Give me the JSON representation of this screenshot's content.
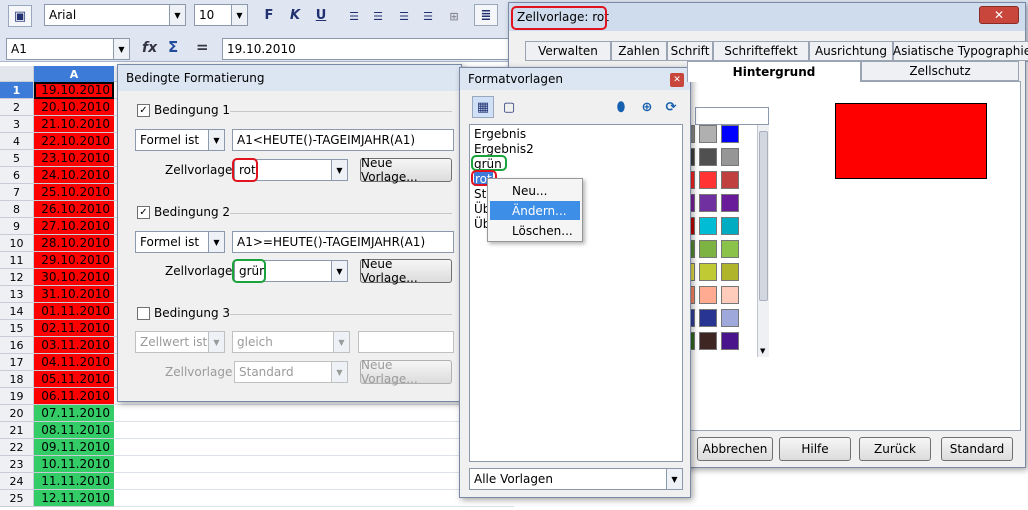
{
  "toolbar": {
    "font_name": "Arial",
    "font_size": "10",
    "bold": "F",
    "italic": "K",
    "underline": "U"
  },
  "formula_bar": {
    "cell_ref": "A1",
    "content": "19.10.2010",
    "fx": "fx",
    "sum": "Σ",
    "eq": "="
  },
  "sheet": {
    "column_header": "A",
    "rows": [
      {
        "n": "1",
        "v": "19.10.2010",
        "c": "red"
      },
      {
        "n": "2",
        "v": "20.10.2010",
        "c": "red"
      },
      {
        "n": "3",
        "v": "21.10.2010",
        "c": "red"
      },
      {
        "n": "4",
        "v": "22.10.2010",
        "c": "red"
      },
      {
        "n": "5",
        "v": "23.10.2010",
        "c": "red"
      },
      {
        "n": "6",
        "v": "24.10.2010",
        "c": "red"
      },
      {
        "n": "7",
        "v": "25.10.2010",
        "c": "red"
      },
      {
        "n": "8",
        "v": "26.10.2010",
        "c": "red"
      },
      {
        "n": "9",
        "v": "27.10.2010",
        "c": "red"
      },
      {
        "n": "10",
        "v": "28.10.2010",
        "c": "red"
      },
      {
        "n": "11",
        "v": "29.10.2010",
        "c": "red"
      },
      {
        "n": "12",
        "v": "30.10.2010",
        "c": "red"
      },
      {
        "n": "13",
        "v": "31.10.2010",
        "c": "red"
      },
      {
        "n": "14",
        "v": "01.11.2010",
        "c": "red"
      },
      {
        "n": "15",
        "v": "02.11.2010",
        "c": "red"
      },
      {
        "n": "16",
        "v": "03.11.2010",
        "c": "red"
      },
      {
        "n": "17",
        "v": "04.11.2010",
        "c": "red"
      },
      {
        "n": "18",
        "v": "05.11.2010",
        "c": "red"
      },
      {
        "n": "19",
        "v": "06.11.2010",
        "c": "red"
      },
      {
        "n": "20",
        "v": "07.11.2010",
        "c": "green"
      },
      {
        "n": "21",
        "v": "08.11.2010",
        "c": "green"
      },
      {
        "n": "22",
        "v": "09.11.2010",
        "c": "green"
      },
      {
        "n": "23",
        "v": "10.11.2010",
        "c": "green"
      },
      {
        "n": "24",
        "v": "11.11.2010",
        "c": "green"
      },
      {
        "n": "25",
        "v": "12.11.2010",
        "c": "green"
      }
    ],
    "colors": {
      "red": "#ff0000",
      "green": "#33cc66"
    }
  },
  "cond_dialog": {
    "title": "Bedingte Formatierung",
    "cond1": {
      "label": "Bedingung 1",
      "type": "Formel ist",
      "formula": "A1<HEUTE()-TAGEIMJAHR(A1)",
      "style_label": "Zellvorlage",
      "style": "rot",
      "new_btn": "Neue Vorlage..."
    },
    "cond2": {
      "label": "Bedingung 2",
      "type": "Formel ist",
      "formula": "A1>=HEUTE()-TAGEIMJAHR(A1)",
      "style_label": "Zellvorlage",
      "style": "grün",
      "new_btn": "Neue Vorlage..."
    },
    "cond3": {
      "label": "Bedingung 3",
      "type": "Zellwert ist",
      "op": "gleich",
      "style_label": "Zellvorlage",
      "style": "Standard",
      "new_btn": "Neue Vorlage..."
    }
  },
  "styles_panel": {
    "title": "Formatvorlagen",
    "items": [
      "Ergebnis",
      "Ergebnis2",
      "grün",
      "rot",
      "Sta",
      "Üb",
      "Üb"
    ],
    "filter": "Alle Vorlagen"
  },
  "context_menu": {
    "items": [
      "Neu...",
      "Ändern...",
      "Löschen..."
    ]
  },
  "cell_style_dialog": {
    "title": "Zellvorlage: rot",
    "tabs_row1": [
      "Verwalten",
      "Zahlen",
      "Schrift",
      "Schrifteffekt",
      "Ausrichtung",
      "Asiatische Typographie"
    ],
    "tabs_row2": [
      "Hintergrund",
      "Zellschutz"
    ],
    "buttons": [
      "Abbrechen",
      "Hilfe",
      "Zurück",
      "Standard"
    ],
    "preview_color": "#ff0000",
    "palette": [
      [
        "#b0b0b0",
        "#0000ff"
      ],
      [
        "#505050",
        "#969696"
      ],
      [
        "#ff3333",
        "#c04040"
      ],
      [
        "#7030a0",
        "#6a1b9a"
      ],
      [
        "#00bcd4",
        "#00acc1"
      ],
      [
        "#7cb342",
        "#8bc34a"
      ],
      [
        "#c0ca33",
        "#afb42b"
      ],
      [
        "#ffab91",
        "#ffccbc"
      ],
      [
        "#283593",
        "#9fa8da"
      ],
      [
        "#3e2723",
        "#4a148c"
      ]
    ],
    "palette_left": [
      "#8a8a8a",
      "#404040",
      "#ff2020",
      "#8020a0",
      "#c00000",
      "#558b2f",
      "#e6e04a",
      "#ff8a65",
      "#303f9f",
      "#33691e"
    ]
  }
}
